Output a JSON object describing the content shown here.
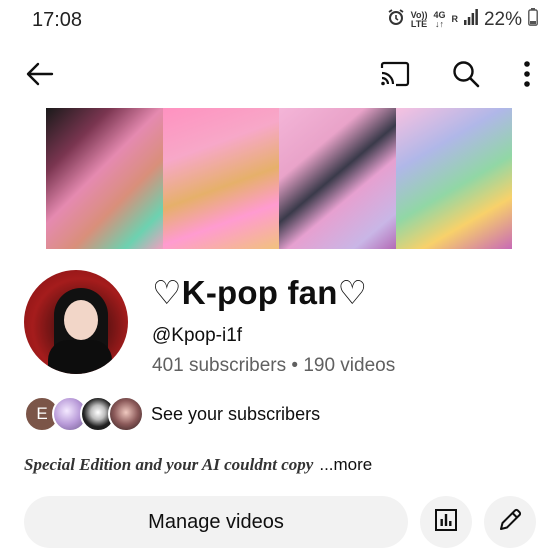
{
  "status_bar": {
    "time": "17:08",
    "volte_top": "Vo))",
    "volte_bottom": "LTE",
    "network_top": "4G",
    "network_bottom": "↓↑",
    "roaming": "R",
    "battery": "22%",
    "icons": [
      "alarm-icon",
      "signal-icon",
      "battery-icon"
    ]
  },
  "top_bar": {
    "icons": [
      "back-arrow-icon",
      "cast-icon",
      "search-icon",
      "more-vert-icon"
    ]
  },
  "channel": {
    "name": "♡K-pop fan♡",
    "handle": "@Kpop-i1f",
    "stats": "401 subscribers • 190 videos",
    "subscriber_initial": "E",
    "see_subscribers": "See your subscribers",
    "description": "Special Edition and your AI couldnt copy",
    "more": "...more"
  },
  "actions": {
    "manage_videos": "Manage videos",
    "icons": [
      "analytics-icon",
      "edit-icon"
    ]
  },
  "colors": {
    "button_bg": "#f2f2f2",
    "secondary_text": "#606060",
    "primary_text": "#0f0f0f"
  }
}
